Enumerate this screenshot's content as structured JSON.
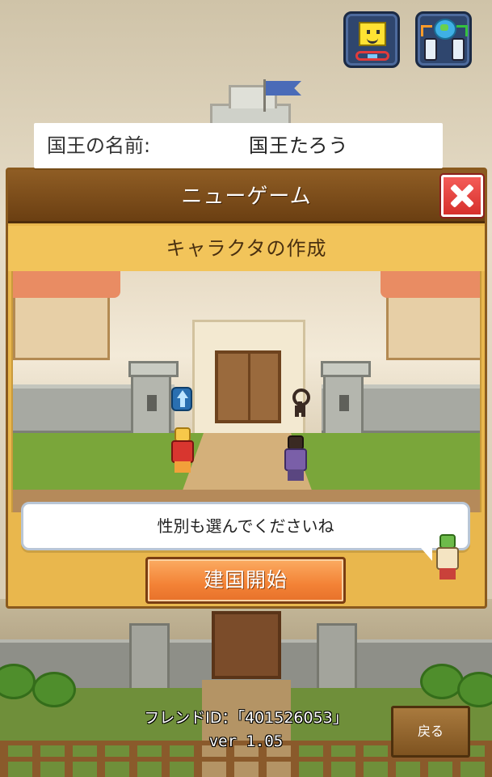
{
  "top_icons": [
    {
      "name": "smile-chain-icon"
    },
    {
      "name": "device-transfer-icon"
    }
  ],
  "dialog": {
    "title": "ニューゲーム",
    "subtitle": "キャラクタの作成",
    "name_label": "国王の名前:",
    "name_value": "国王たろう",
    "speech": "性別も選んでくださいね",
    "start_button": "建国開始"
  },
  "footer": {
    "friend_id": "フレンドID：「401526053」",
    "version": "ver 1.05",
    "back_button": "戻る"
  },
  "colors": {
    "dialog_bg": "#e9b74d",
    "header_bg": "#7a4a18",
    "close_red": "#e84440",
    "start_orange": "#f38236"
  }
}
